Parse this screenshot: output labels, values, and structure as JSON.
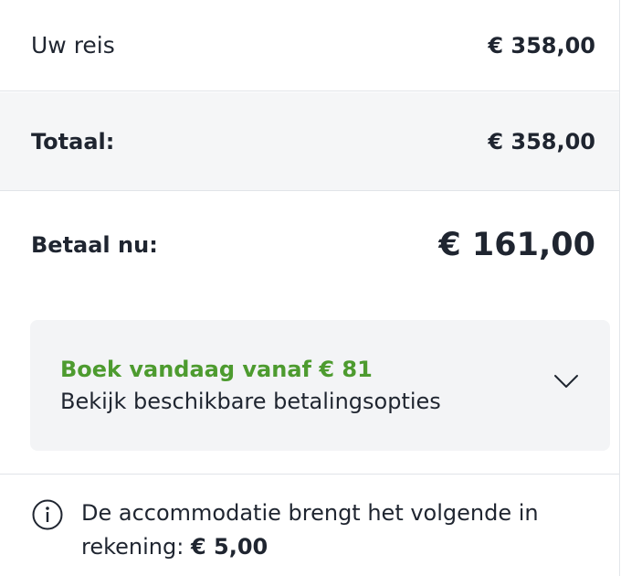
{
  "trip": {
    "label": "Uw reis",
    "amount": "€ 358,00"
  },
  "total": {
    "label": "Totaal:",
    "amount": "€ 358,00"
  },
  "pay_now": {
    "label": "Betaal nu:",
    "amount": "€ 161,00"
  },
  "payment_options": {
    "promo": "Boek vandaag vanaf € 81",
    "link_text": "Bekijk beschikbare betalingsopties",
    "icon": "chevron-down-icon"
  },
  "notice": {
    "icon": "info-icon",
    "text": "De accommodatie brengt het volgende in rekening:",
    "amount": "€ 5,00"
  },
  "colors": {
    "promo_green": "#4d9b2f",
    "text_dark": "#1f2530",
    "panel_background": "#f3f4f6",
    "total_row_background": "#f5f6f7",
    "divider": "#e1e4e8"
  }
}
